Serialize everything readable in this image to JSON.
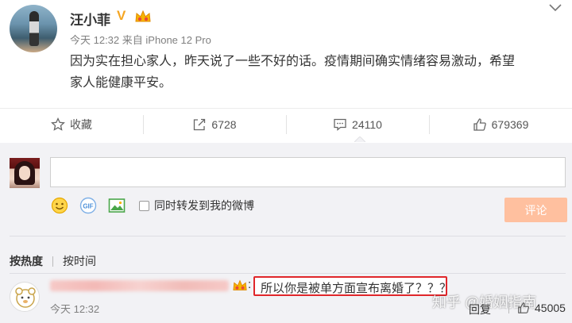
{
  "post": {
    "username": "汪小菲",
    "verified_badge": "V",
    "time": "今天 12:32",
    "source_prefix": "来自",
    "source": "iPhone 12 Pro",
    "text_line1": "因为实在担心家人，昨天说了一些不好的话。疫情期间确实情绪容易激动，希望",
    "text_line2": "家人能健康平安。"
  },
  "actions": {
    "favorite_label": "收藏",
    "repost_count": "6728",
    "comment_count": "24110",
    "like_count": "679369"
  },
  "composer": {
    "share_checkbox_label": "同时转发到我的微博",
    "submit_label": "评论",
    "gif_label": "GIF"
  },
  "sort": {
    "hot_label": "按热度",
    "time_label": "按时间"
  },
  "comment": {
    "colon": ":",
    "text": "所以你是被单方面宣布离婚了？？？",
    "time": "今天 12:32",
    "reply_label": "回复",
    "like_count": "45005"
  },
  "watermark": "知乎 @婚姻指南",
  "colors": {
    "accent_orange": "#ffc09f",
    "highlight_red": "#e0262a",
    "badge_gold": "#f5a623"
  }
}
